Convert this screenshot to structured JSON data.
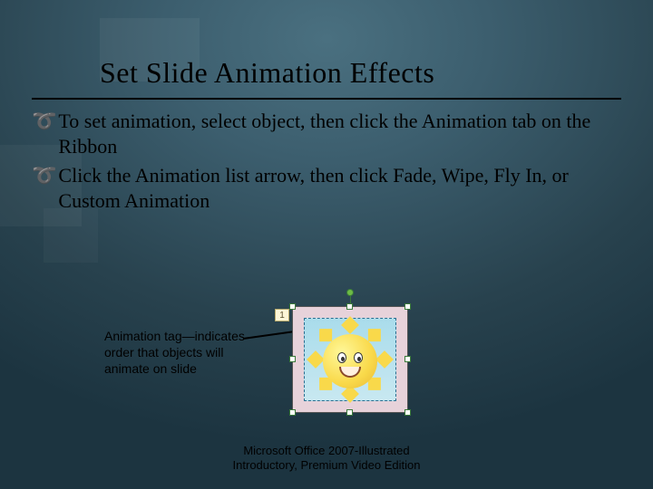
{
  "title": "Set Slide Animation Effects",
  "bullets": [
    "To set animation, select object, then click the Animation tab on the Ribbon",
    "Click the Animation list arrow, then click Fade, Wipe, Fly In, or Custom Animation"
  ],
  "callout": "Animation tag—indicates order that objects will animate on slide",
  "animation_tag_number": "1",
  "footer_line1": "Microsoft Office 2007-Illustrated",
  "footer_line2": "Introductory, Premium Video Edition"
}
